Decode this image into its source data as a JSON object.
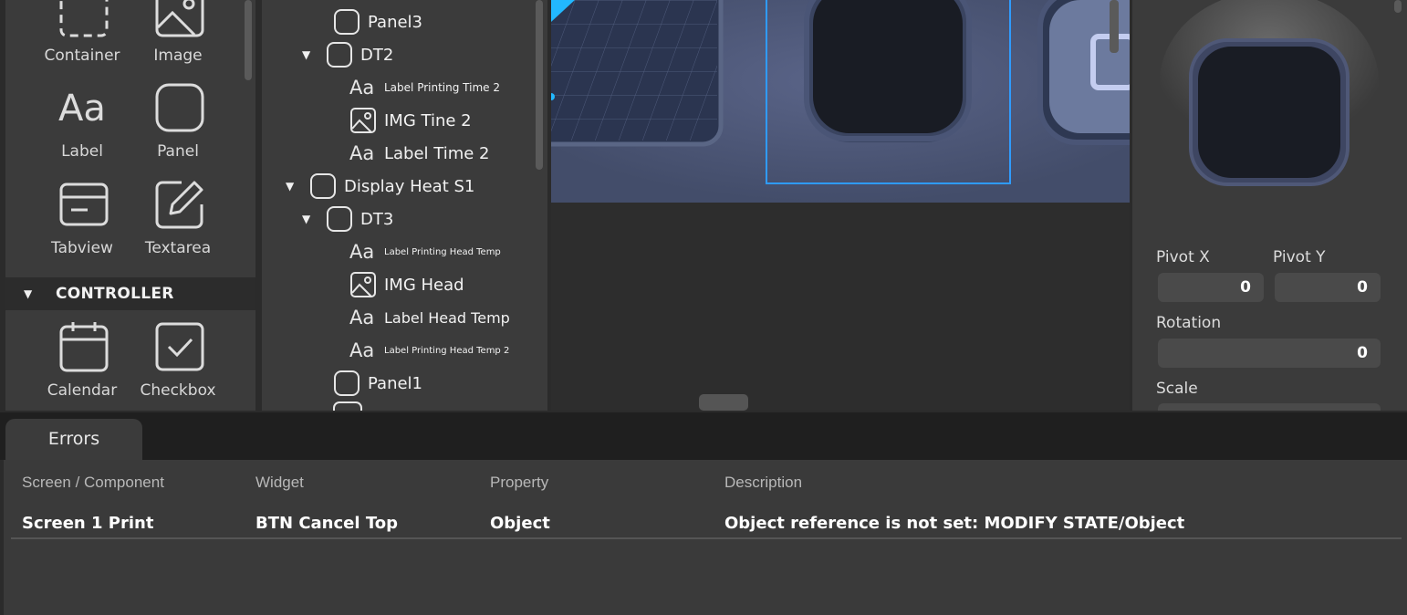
{
  "palette": {
    "widgets": [
      {
        "label": "Container",
        "icon": "container-icon"
      },
      {
        "label": "Image",
        "icon": "image-icon"
      },
      {
        "label": "Label",
        "icon": "label-icon"
      },
      {
        "label": "Panel",
        "icon": "panel-icon"
      },
      {
        "label": "Tabview",
        "icon": "tabview-icon"
      },
      {
        "label": "Textarea",
        "icon": "textarea-icon"
      }
    ],
    "controller_section": {
      "title": "CONTROLLER",
      "widgets": [
        {
          "label": "Calendar",
          "icon": "calendar-icon"
        },
        {
          "label": "Checkbox",
          "icon": "checkbox-icon"
        }
      ]
    }
  },
  "tree": {
    "nodes": [
      {
        "label": "Panel3",
        "type": "panel",
        "expandable": false
      },
      {
        "label": "DT2",
        "type": "panel",
        "expandable": true
      },
      {
        "label": "Label Printing Time 2",
        "type": "label",
        "expandable": false
      },
      {
        "label": "IMG Tine 2",
        "type": "image",
        "expandable": false
      },
      {
        "label": "Label Time 2",
        "type": "label",
        "expandable": false
      },
      {
        "label": "Display Heat S1",
        "type": "panel",
        "expandable": true
      },
      {
        "label": "DT3",
        "type": "panel",
        "expandable": true
      },
      {
        "label": "Label Printing Head Temp",
        "type": "label",
        "expandable": false
      },
      {
        "label": "IMG Head",
        "type": "image",
        "expandable": false
      },
      {
        "label": "Label Head Temp",
        "type": "label",
        "expandable": false
      },
      {
        "label": "Label Printing Head Temp 2",
        "type": "label",
        "expandable": false
      },
      {
        "label": "Panel1",
        "type": "panel",
        "expandable": false
      }
    ]
  },
  "canvas": {
    "selection_color": "#2f9bff",
    "background_color": "#434d6a"
  },
  "properties": {
    "pivot_x_label": "Pivot X",
    "pivot_x_value": "0",
    "pivot_y_label": "Pivot Y",
    "pivot_y_value": "0",
    "rotation_label": "Rotation",
    "rotation_value": "0",
    "scale_label": "Scale"
  },
  "errors": {
    "tab_label": "Errors",
    "columns": [
      "Screen / Component",
      "Widget",
      "Property",
      "Description"
    ],
    "rows": [
      [
        "Screen 1 Print",
        "BTN Cancel Top",
        "Object",
        "Object reference is not set: MODIFY STATE/Object"
      ]
    ]
  }
}
